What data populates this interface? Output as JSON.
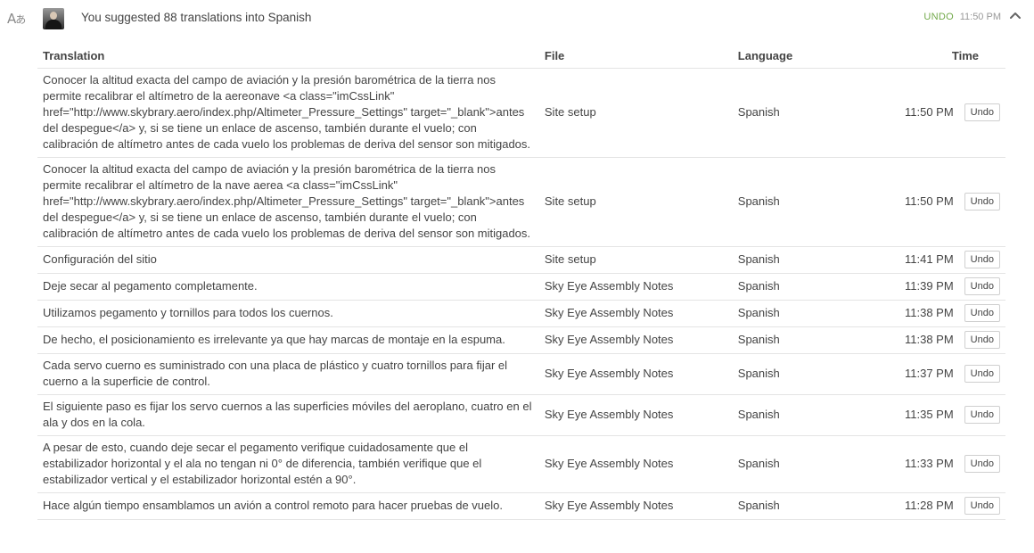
{
  "header": {
    "summary": "You suggested 88 translations into Spanish",
    "undo_label": "UNDO",
    "time": "11:50 PM",
    "activity_icon": "translate-icon",
    "collapse_icon": "chevron-up-icon"
  },
  "table": {
    "columns": {
      "translation": "Translation",
      "file": "File",
      "language": "Language",
      "time": "Time"
    },
    "undo_label": "Undo",
    "rows": [
      {
        "translation": "Conocer la altitud exacta del campo de aviación y la presión barométrica de la tierra nos permite recalibrar el altímetro de la aereonave <a class=\"imCssLink\" href=\"http://www.skybrary.aero/index.php/Altimeter_Pressure_Settings\" target=\"_blank\">antes del despegue</a> y, si se tiene un enlace de ascenso, también durante el vuelo; con calibración de altímetro antes de cada vuelo los problemas de deriva del sensor son mitigados.",
        "file": "Site setup",
        "language": "Spanish",
        "time": "11:50 PM"
      },
      {
        "translation": "Conocer la altitud exacta del campo de aviación y la presión barométrica de la tierra nos permite recalibrar el altímetro de la nave aerea <a class=\"imCssLink\" href=\"http://www.skybrary.aero/index.php/Altimeter_Pressure_Settings\" target=\"_blank\">antes del despegue</a> y, si se tiene un enlace de ascenso, también durante el vuelo; con calibración de altímetro antes de cada vuelo los problemas de deriva del sensor son mitigados.",
        "file": "Site setup",
        "language": "Spanish",
        "time": "11:50 PM"
      },
      {
        "translation": "Configuración del sitio",
        "file": "Site setup",
        "language": "Spanish",
        "time": "11:41 PM"
      },
      {
        "translation": "Deje secar al pegamento completamente.",
        "file": "Sky Eye Assembly Notes",
        "language": "Spanish",
        "time": "11:39 PM"
      },
      {
        "translation": "Utilizamos pegamento y tornillos para todos los cuernos.",
        "file": "Sky Eye Assembly Notes",
        "language": "Spanish",
        "time": "11:38 PM"
      },
      {
        "translation": "De hecho, el posicionamiento es irrelevante ya que hay marcas de montaje en la espuma.",
        "file": "Sky Eye Assembly Notes",
        "language": "Spanish",
        "time": "11:38 PM"
      },
      {
        "translation": "Cada servo cuerno es suministrado con una placa de plástico y cuatro tornillos para fijar el cuerno a la superficie de control.",
        "file": "Sky Eye Assembly Notes",
        "language": "Spanish",
        "time": "11:37 PM"
      },
      {
        "translation": "El siguiente paso es fijar los servo cuernos a las superficies móviles del aeroplano, cuatro en el ala y dos en la cola.",
        "file": "Sky Eye Assembly Notes",
        "language": "Spanish",
        "time": "11:35 PM"
      },
      {
        "translation": "A pesar de esto, cuando deje secar el pegamento verifique cuidadosamente que el estabilizador horizontal y el ala no tengan ni 0° de diferencia, también verifique que el estabilizador vertical y el estabilizador horizontal estén a 90°.",
        "file": "Sky Eye Assembly Notes",
        "language": "Spanish",
        "time": "11:33 PM"
      },
      {
        "translation": "Hace algún tiempo ensamblamos un avión a control remoto para hacer pruebas de vuelo.",
        "file": "Sky Eye Assembly Notes",
        "language": "Spanish",
        "time": "11:28 PM"
      }
    ]
  }
}
